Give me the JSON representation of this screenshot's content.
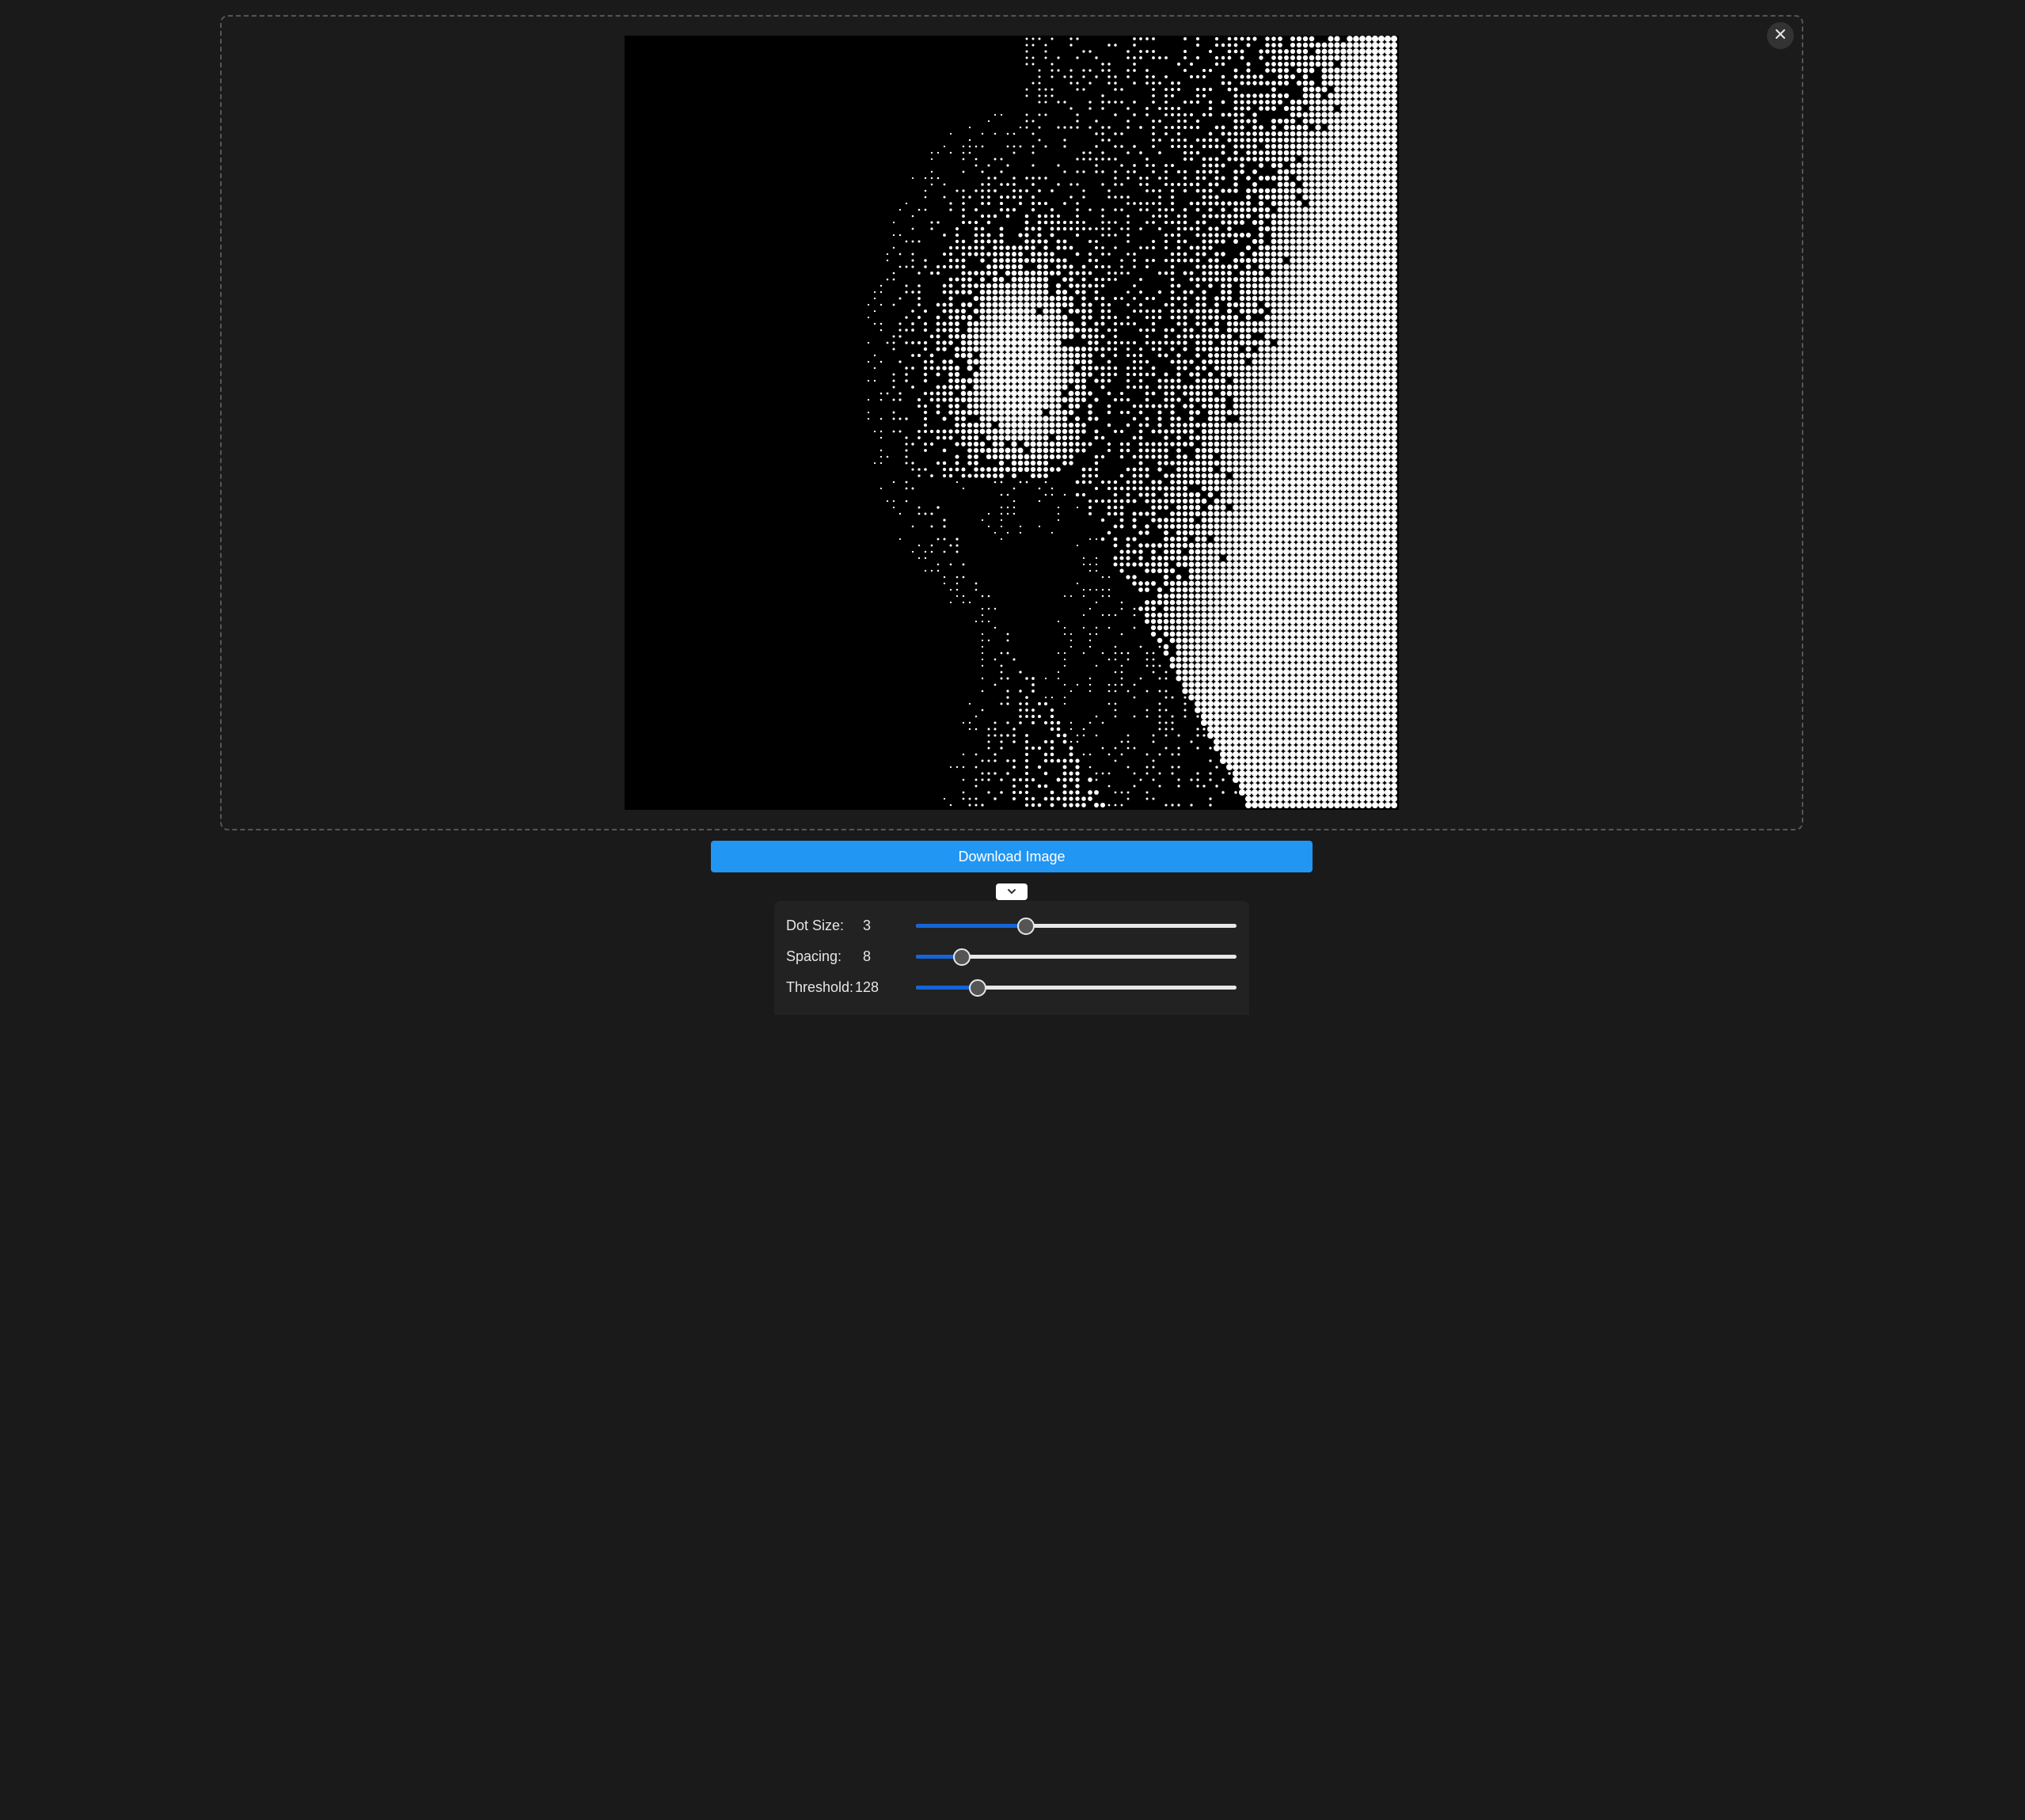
{
  "close_icon": "close-icon",
  "download": {
    "label": "Download Image"
  },
  "toggle": {
    "icon": "chevron-down-icon"
  },
  "controls": [
    {
      "label": "Dot Size:",
      "value": "3",
      "fraction": 0.34
    },
    {
      "label": "Spacing:",
      "value": "8",
      "fraction": 0.14
    },
    {
      "label": "Threshold:",
      "value": "128",
      "fraction": 0.19
    }
  ],
  "colors": {
    "background": "#1a1a1a",
    "accent": "#2196f3",
    "slider_fill": "#1565d8",
    "preview_bg": "#000000"
  }
}
